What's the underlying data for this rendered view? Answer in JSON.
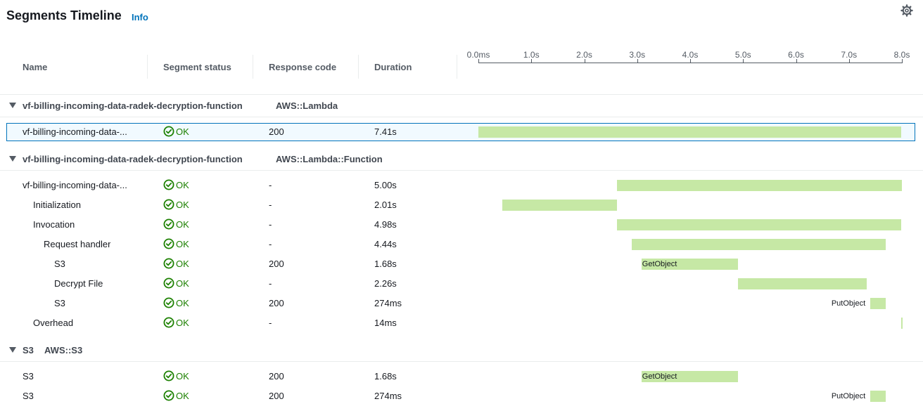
{
  "header": {
    "title": "Segments Timeline",
    "info_label": "Info",
    "settings_icon": "gear-icon"
  },
  "columns": {
    "name": "Name",
    "status": "Segment status",
    "response": "Response code",
    "duration": "Duration"
  },
  "timeline_axis": {
    "ticks": [
      "0.0ms",
      "1.0s",
      "2.0s",
      "3.0s",
      "4.0s",
      "5.0s",
      "6.0s",
      "7.0s",
      "8.0s"
    ],
    "max_seconds": 8.0
  },
  "colors": {
    "bar": "#c6e8a5",
    "ok": "#1d8102",
    "link": "#0073bb",
    "selected_border": "#0073bb"
  },
  "groups": [
    {
      "name": "vf-billing-incoming-data-radek-decryption-function",
      "type": "AWS::Lambda",
      "rows": [
        {
          "name": "vf-billing-incoming-data-...",
          "status": "OK",
          "response": "200",
          "duration": "7.41s",
          "start": 0.0,
          "end": 7.99,
          "label": "",
          "selected": true
        }
      ]
    },
    {
      "name": "vf-billing-incoming-data-radek-decryption-function",
      "type": "AWS::Lambda::Function",
      "rows": [
        {
          "name": "vf-billing-incoming-data-...",
          "status": "OK",
          "response": "-",
          "duration": "5.00s",
          "start": 2.62,
          "end": 8.0,
          "label": ""
        },
        {
          "name": "Initialization",
          "status": "OK",
          "response": "-",
          "duration": "2.01s",
          "start": 0.45,
          "end": 2.62,
          "label": ""
        },
        {
          "name": "Invocation",
          "status": "OK",
          "response": "-",
          "duration": "4.98s",
          "start": 2.62,
          "end": 7.99,
          "label": ""
        },
        {
          "name": "Request handler",
          "status": "OK",
          "response": "-",
          "duration": "4.44s",
          "start": 2.9,
          "end": 7.7,
          "label": ""
        },
        {
          "name": "S3",
          "status": "OK",
          "response": "200",
          "duration": "1.68s",
          "start": 3.08,
          "end": 4.9,
          "label": "GetObject"
        },
        {
          "name": "Decrypt File",
          "status": "OK",
          "response": "-",
          "duration": "2.26s",
          "start": 4.9,
          "end": 7.34,
          "label": ""
        },
        {
          "name": "S3",
          "status": "OK",
          "response": "200",
          "duration": "274ms",
          "start": 7.4,
          "end": 7.7,
          "label": "PutObject"
        },
        {
          "name": "Overhead",
          "status": "OK",
          "response": "-",
          "duration": "14ms",
          "start": 7.99,
          "end": 8.0,
          "label": ""
        }
      ]
    },
    {
      "name": "S3",
      "type": "AWS::S3",
      "rows": [
        {
          "name": "S3",
          "status": "OK",
          "response": "200",
          "duration": "1.68s",
          "start": 3.08,
          "end": 4.9,
          "label": "GetObject"
        },
        {
          "name": "S3",
          "status": "OK",
          "response": "200",
          "duration": "274ms",
          "start": 7.4,
          "end": 7.7,
          "label": "PutObject"
        }
      ]
    }
  ]
}
